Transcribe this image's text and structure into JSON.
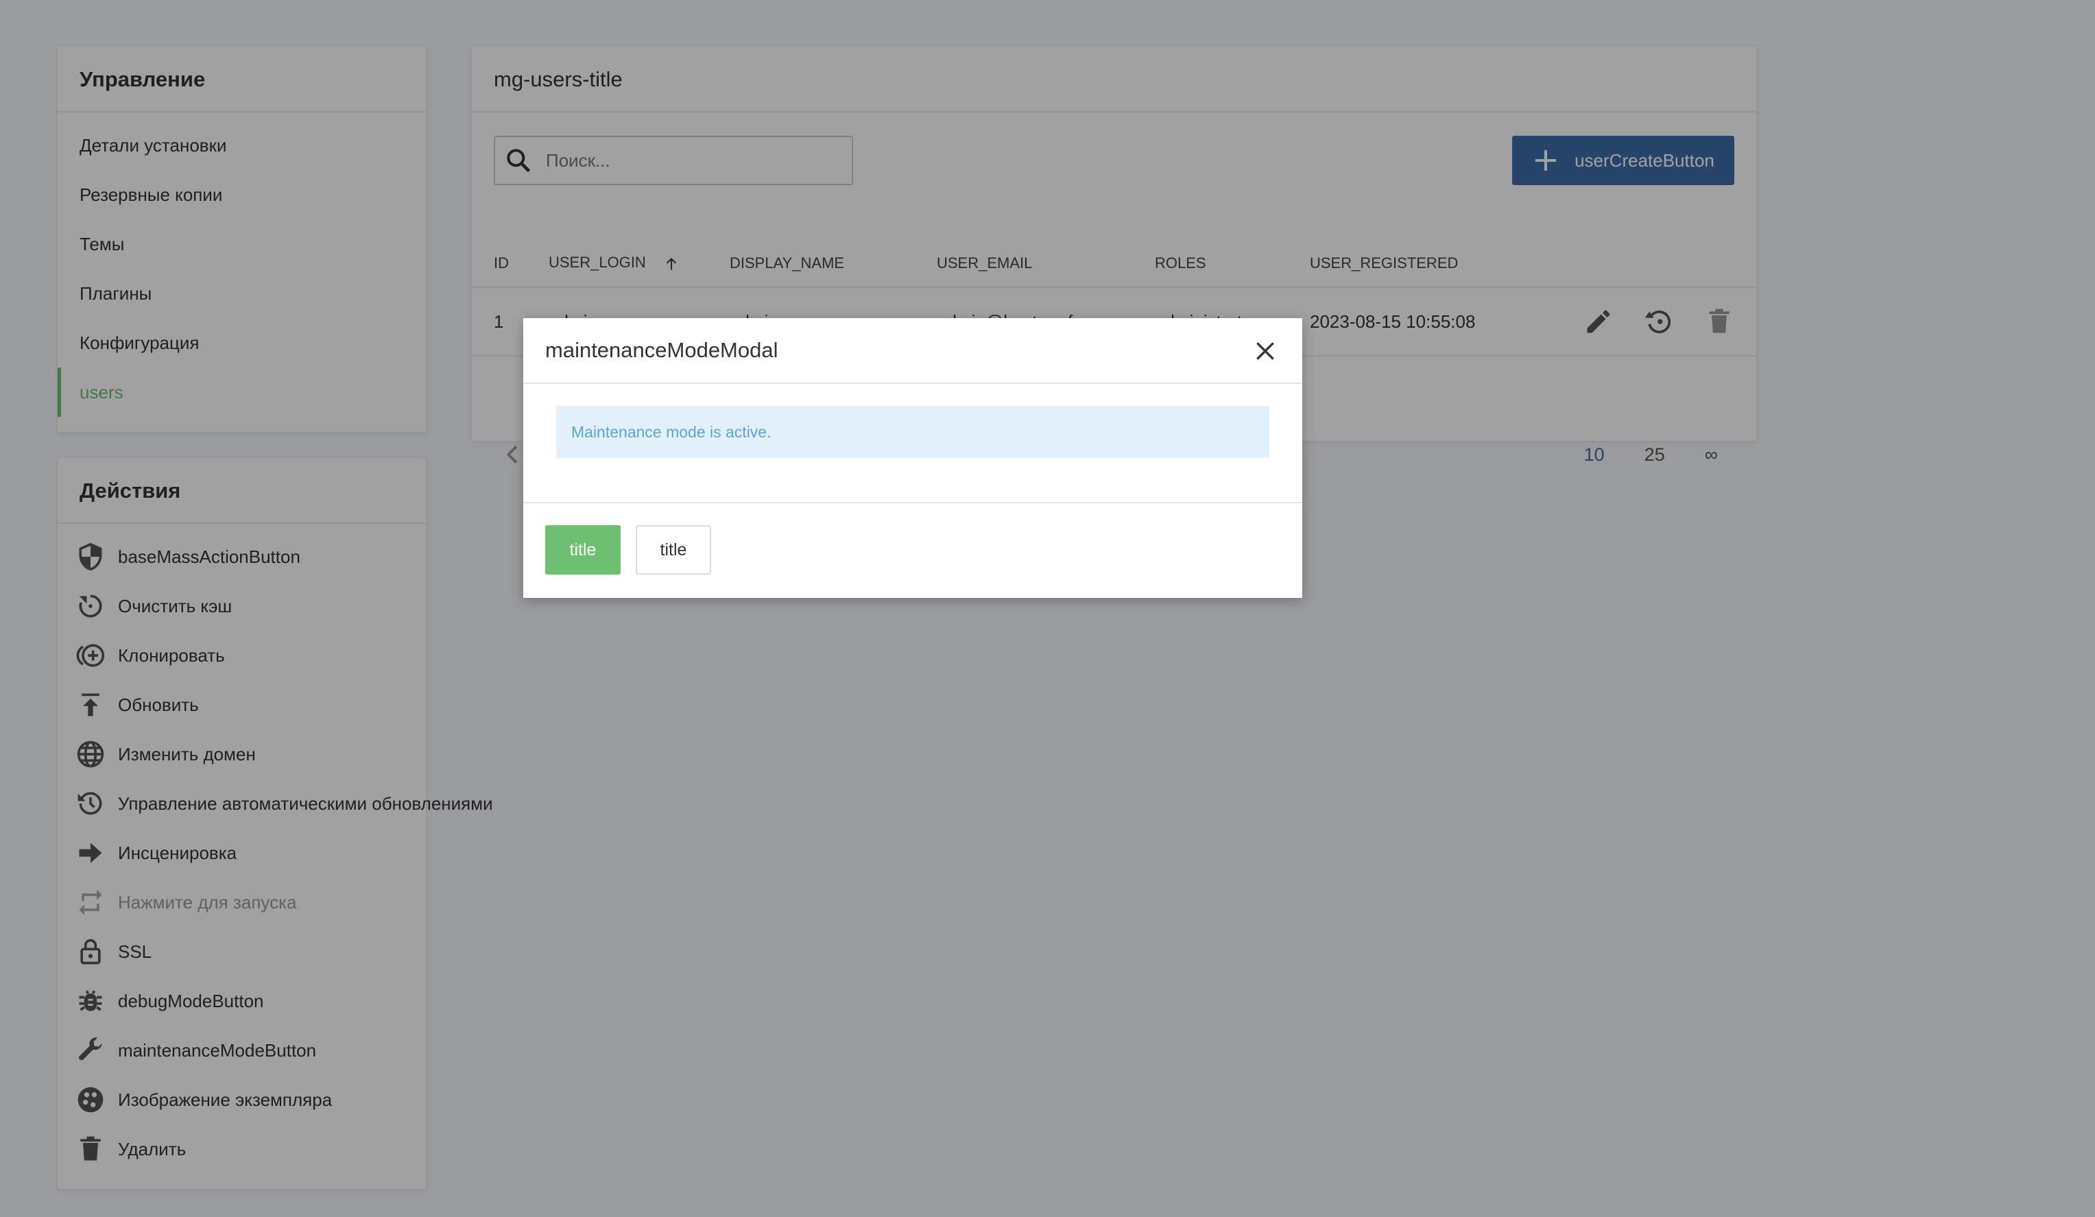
{
  "management": {
    "title": "Управление",
    "items": [
      {
        "label": "Детали установки"
      },
      {
        "label": "Резервные копии"
      },
      {
        "label": "Темы"
      },
      {
        "label": "Плагины"
      },
      {
        "label": "Конфигурация"
      },
      {
        "label": "users",
        "active": true
      }
    ]
  },
  "actions": {
    "title": "Действия",
    "items": [
      {
        "label": "baseMassActionButton",
        "icon": "shield-icon"
      },
      {
        "label": "Очистить кэш",
        "icon": "refresh-icon"
      },
      {
        "label": "Клонировать",
        "icon": "clone-icon"
      },
      {
        "label": "Обновить",
        "icon": "upload-icon"
      },
      {
        "label": "Изменить домен",
        "icon": "globe-icon"
      },
      {
        "label": "Управление автоматическими обновлениями",
        "icon": "history-icon"
      },
      {
        "label": "Инсценировка",
        "icon": "arrow-right-icon"
      },
      {
        "label": "Нажмите для запуска",
        "icon": "repeat-icon",
        "disabled": true
      },
      {
        "label": "SSL",
        "icon": "lock-icon"
      },
      {
        "label": "debugModeButton",
        "icon": "bug-icon"
      },
      {
        "label": "maintenanceModeButton",
        "icon": "wrench-icon"
      },
      {
        "label": "Изображение экземпляра",
        "icon": "image-icon"
      },
      {
        "label": "Удалить",
        "icon": "trash-icon"
      }
    ]
  },
  "users": {
    "title": "mg-users-title",
    "search_placeholder": "Поиск...",
    "create_label": "userCreateButton",
    "columns": [
      "ID",
      "USER_LOGIN",
      "DISPLAY_NAME",
      "USER_EMAIL",
      "ROLES",
      "USER_REGISTERED"
    ],
    "sort_column": "USER_LOGIN",
    "sort_direction": "asc",
    "rows": [
      [
        "1",
        "admin",
        "admin",
        "admin@hostpro.fun",
        "administrator",
        "2023-08-15 10:55:08"
      ]
    ],
    "page_sizes": [
      "10",
      "25",
      "∞"
    ],
    "current_page_size": "10"
  },
  "modal": {
    "title": "maintenanceModeModal",
    "message": "Maintenance mode is active.",
    "primary_label": "title",
    "secondary_label": "title"
  },
  "colors": {
    "accent_green": "#6cc070",
    "primary_blue": "#3f6ea8",
    "info_bg": "#e1f0fb",
    "info_text": "#5aa4d8"
  }
}
